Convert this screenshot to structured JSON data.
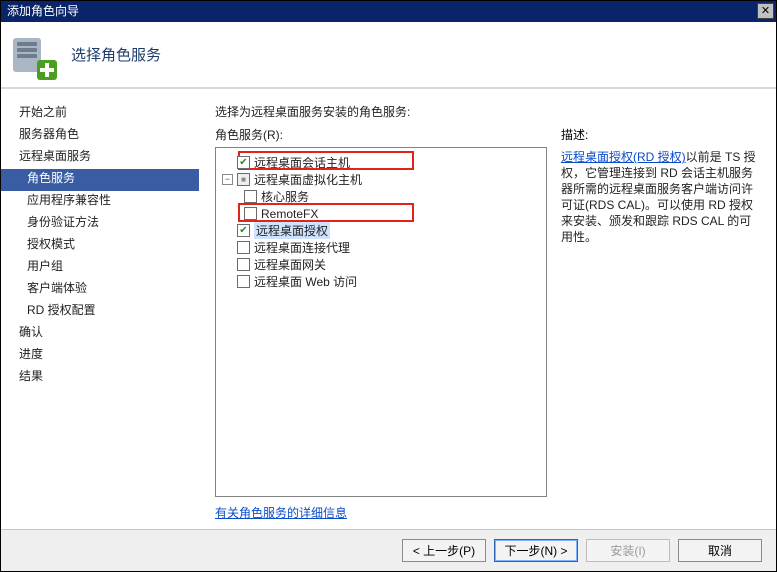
{
  "window": {
    "title": "添加角色向导"
  },
  "header": {
    "title": "选择角色服务"
  },
  "nav": {
    "items": [
      {
        "label": "开始之前",
        "selected": false,
        "sub": false
      },
      {
        "label": "服务器角色",
        "selected": false,
        "sub": false
      },
      {
        "label": "远程桌面服务",
        "selected": false,
        "sub": false
      },
      {
        "label": "角色服务",
        "selected": true,
        "sub": true
      },
      {
        "label": "应用程序兼容性",
        "selected": false,
        "sub": true
      },
      {
        "label": "身份验证方法",
        "selected": false,
        "sub": true
      },
      {
        "label": "授权模式",
        "selected": false,
        "sub": true
      },
      {
        "label": "用户组",
        "selected": false,
        "sub": true
      },
      {
        "label": "客户端体验",
        "selected": false,
        "sub": true
      },
      {
        "label": "RD 授权配置",
        "selected": false,
        "sub": true
      },
      {
        "label": "确认",
        "selected": false,
        "sub": false
      },
      {
        "label": "进度",
        "selected": false,
        "sub": false
      },
      {
        "label": "结果",
        "selected": false,
        "sub": false
      }
    ]
  },
  "content": {
    "prompt": "选择为远程桌面服务安装的角色服务:",
    "tree_label": "角色服务(R):",
    "desc_label": "描述:",
    "tree": [
      {
        "label": "远程桌面会话主机",
        "checked": "checked",
        "indent": 0,
        "toggle": null,
        "highlighted": false
      },
      {
        "label": "远程桌面虚拟化主机",
        "checked": "mixed",
        "indent": 0,
        "toggle": "minus",
        "highlighted": false
      },
      {
        "label": "核心服务",
        "checked": "none",
        "indent": 1,
        "toggle": null,
        "highlighted": false
      },
      {
        "label": "RemoteFX",
        "checked": "none",
        "indent": 1,
        "toggle": null,
        "highlighted": false
      },
      {
        "label": "远程桌面授权",
        "checked": "checked",
        "indent": 0,
        "toggle": null,
        "highlighted": true
      },
      {
        "label": "远程桌面连接代理",
        "checked": "none",
        "indent": 0,
        "toggle": null,
        "highlighted": false
      },
      {
        "label": "远程桌面网关",
        "checked": "none",
        "indent": 0,
        "toggle": null,
        "highlighted": false
      },
      {
        "label": "远程桌面 Web 访问",
        "checked": "none",
        "indent": 0,
        "toggle": null,
        "highlighted": false
      }
    ],
    "description": {
      "link_text": "远程桌面授权(RD 授权)",
      "body": "以前是 TS 授权，它管理连接到 RD 会话主机服务器所需的远程桌面服务客户端访问许可证(RDS CAL)。可以使用 RD 授权来安装、颁发和跟踪 RDS CAL 的可用性。"
    },
    "more_link": "有关角色服务的详细信息"
  },
  "footer": {
    "prev": "< 上一步(P)",
    "next": "下一步(N) >",
    "install": "安装(I)",
    "cancel": "取消"
  }
}
